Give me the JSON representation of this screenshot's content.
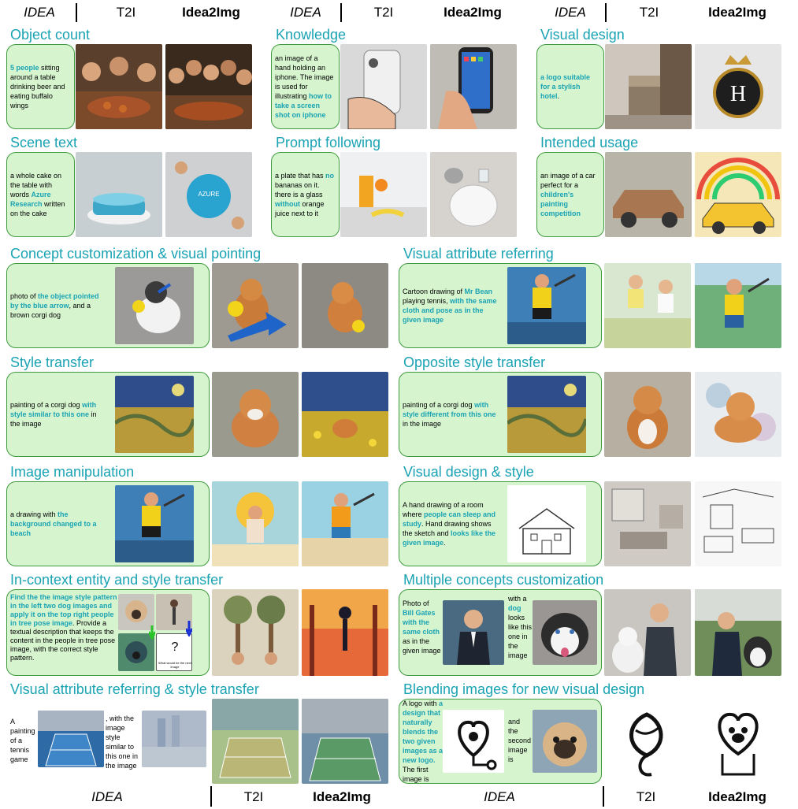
{
  "header_labels": {
    "idea": "IDEA",
    "t2i": "T2I",
    "idea2img": "Idea2Img"
  },
  "sections": {
    "object_count": {
      "title": "Object count",
      "prompt": [
        "",
        "5 people",
        " sitting around a table drinking beer and eating buffalo wings"
      ]
    },
    "knowledge": {
      "title": "Knowledge",
      "prompt": [
        "an image of a hand holding an iphone. The image is used for illustrating ",
        "how to take a screen shot on iphone",
        ""
      ]
    },
    "visual_design": {
      "title": "Visual design",
      "prompt": [
        "",
        "a logo suitable for a stylish hotel",
        "."
      ]
    },
    "scene_text": {
      "title": "Scene text",
      "prompt": [
        "a whole cake on the table with words ",
        "Azure Research",
        " written on the cake"
      ]
    },
    "prompt_following": {
      "title": "Prompt following",
      "prompt": [
        "a plate that has ",
        "no",
        " bananas on it. there is a glass ",
        "without",
        " orange juice next to it"
      ]
    },
    "intended_usage": {
      "title": "Intended usage",
      "prompt": [
        "an image of a car perfect for a ",
        "children's painting competition",
        ""
      ]
    },
    "concept_customization": {
      "title": "Concept customization & visual pointing",
      "prompt": [
        "photo of ",
        "the object pointed by the blue arrow",
        ", and a brown corgi dog"
      ]
    },
    "visual_attribute_referring": {
      "title": "Visual attribute referring",
      "prompt": [
        "Cartoon drawing of ",
        "Mr Bean",
        " playing tennis, ",
        "with the same cloth and pose as in the given image",
        ""
      ]
    },
    "style_transfer": {
      "title": "Style transfer",
      "prompt": [
        "painting of a corgi dog ",
        "with style similar to this one",
        " in the image"
      ]
    },
    "opposite_style_transfer": {
      "title": "Opposite style transfer",
      "prompt": [
        "painting of a corgi dog ",
        "with style different from this one",
        " in the image"
      ]
    },
    "image_manipulation": {
      "title": "Image manipulation",
      "prompt": [
        "a drawing with ",
        "the background changed to a beach",
        ""
      ]
    },
    "visual_design_style": {
      "title": "Visual design & style",
      "prompt": [
        "A hand drawing of a room where ",
        "people can sleep and study",
        ". Hand drawing shows the sketch and ",
        "looks like the given image",
        "."
      ]
    },
    "in_context_entity": {
      "title": "In-context entity and style transfer",
      "prompt": [
        "",
        "Find the the image style pattern in the left two dog images and apply it on the top right people in tree pose image",
        ". Provide a textual description that keeps the content in the people in tree pose image, with the correct style pattern."
      ],
      "question_mark": "?",
      "question_caption": "What would be the next image"
    },
    "multiple_concepts": {
      "title": "Multiple concepts customization",
      "prompt_a": [
        "Photo of ",
        "Bill Gates with the same cloth",
        " as in the given image"
      ],
      "prompt_b": [
        "with a ",
        "dog",
        " looks like this one in the image"
      ]
    },
    "visual_attribute_style": {
      "title": "Visual attribute referring & style transfer",
      "prompt_a": "A painting of a tennis game",
      "prompt_b": ", with the image style similar to this one in the image"
    },
    "blending_images": {
      "title": "Blending images for new visual design",
      "prompt_a": [
        "A logo with ",
        "a design that naturally blends the two given images as a new logo.",
        " The first image is"
      ],
      "prompt_b": "and the second image is"
    }
  },
  "colors": {
    "title": "#1aa3b3",
    "card_bg": "#d6f5cf",
    "card_border": "#3f9a3f"
  }
}
